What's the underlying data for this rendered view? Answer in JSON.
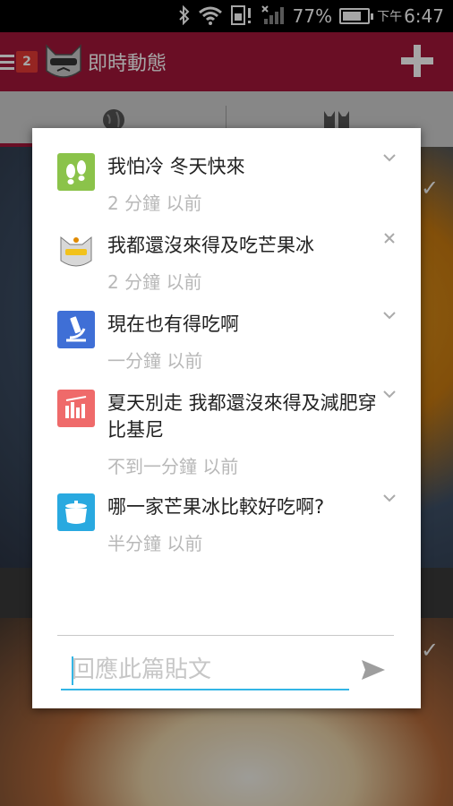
{
  "status_bar": {
    "battery": "77%",
    "ampm": "下午",
    "time": "6:47",
    "battery_level": 0.77
  },
  "app_bar": {
    "badge_count": "2",
    "title": "即時動態"
  },
  "tabs": [
    {
      "icon": "globe-icon"
    },
    {
      "icon": "cats-icon"
    }
  ],
  "dialog": {
    "comments": [
      {
        "text": "我怕冷 冬天快來",
        "time": "2 分鐘 以前",
        "avatar": "footprints-icon",
        "avatar_color": "#8bc34a",
        "action": "chevron-down-icon"
      },
      {
        "text": "我都還沒來得及吃芒果冰",
        "time": "2 分鐘 以前",
        "avatar": "cat-avatar",
        "avatar_color": "#ffffff",
        "action": "close-icon"
      },
      {
        "text": "現在也有得吃啊",
        "time": "一分鐘 以前",
        "avatar": "microscope-icon",
        "avatar_color": "#3f6fd6",
        "action": "chevron-down-icon"
      },
      {
        "text": "夏天別走 我都還沒來得及減肥穿比基尼",
        "time": "不到一分鐘 以前",
        "avatar": "chart-icon",
        "avatar_color": "#ef6a6a",
        "action": "chevron-down-icon"
      },
      {
        "text": "哪一家芒果冰比較好吃啊?",
        "time": "半分鐘 以前",
        "avatar": "pot-icon",
        "avatar_color": "#29a9e0",
        "action": "chevron-down-icon"
      }
    ],
    "reply": {
      "placeholder": "回應此篇貼文",
      "value": ""
    }
  },
  "colors": {
    "brand": "#a4163a",
    "input_accent": "#33b5e5"
  }
}
